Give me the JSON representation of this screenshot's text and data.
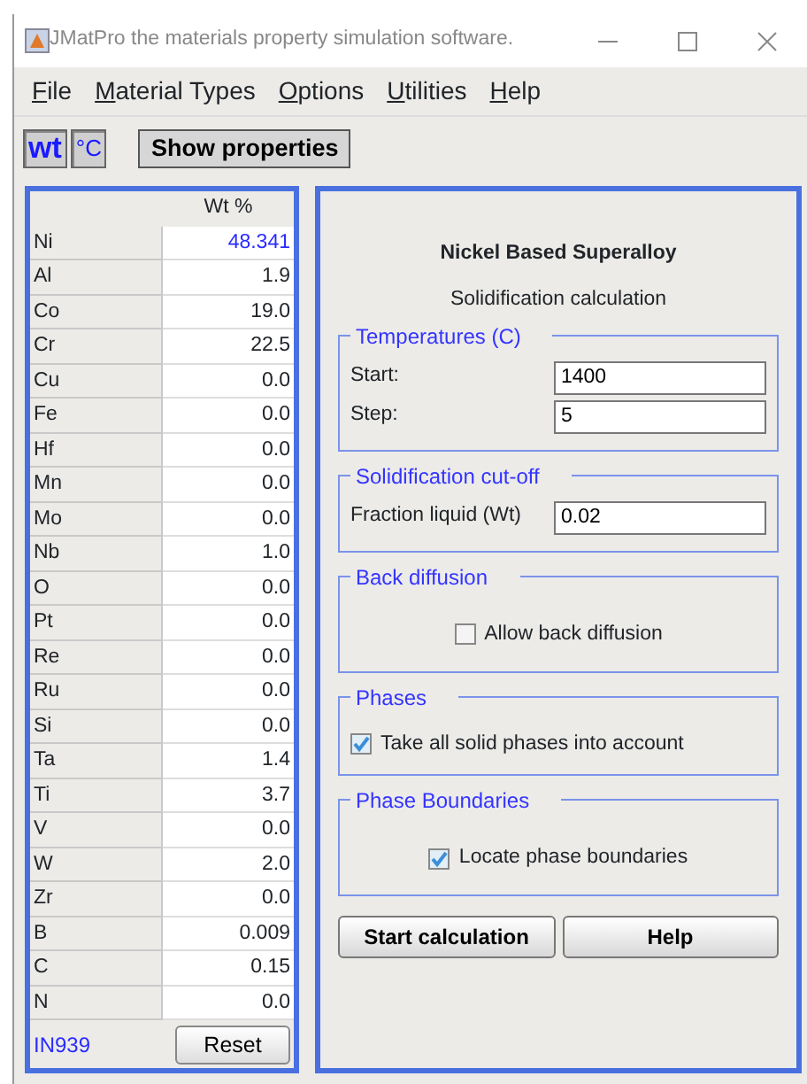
{
  "window": {
    "title": "JMatPro the materials property simulation software."
  },
  "menu": [
    {
      "label": "File",
      "underline_first": true
    },
    {
      "label": "Material Types",
      "underline_first": true
    },
    {
      "label": "Options",
      "underline_first": true
    },
    {
      "label": "Utilities",
      "underline_first": true
    },
    {
      "label": "Help",
      "underline_first": true
    }
  ],
  "toolbar": {
    "units": [
      {
        "label": "wt",
        "selected": true
      },
      {
        "label": "°C",
        "selected": false
      }
    ],
    "show_button": "Show properties"
  },
  "composition": {
    "column_header": "Wt %",
    "rows": [
      {
        "element": "Ni",
        "value": "48.341",
        "highlighted": true
      },
      {
        "element": "Al",
        "value": "1.9",
        "highlighted": false
      },
      {
        "element": "Co",
        "value": "19.0",
        "highlighted": false
      },
      {
        "element": "Cr",
        "value": "22.5",
        "highlighted": false
      },
      {
        "element": "Cu",
        "value": "0.0",
        "highlighted": false
      },
      {
        "element": "Fe",
        "value": "0.0",
        "highlighted": false
      },
      {
        "element": "Hf",
        "value": "0.0",
        "highlighted": false
      },
      {
        "element": "Mn",
        "value": "0.0",
        "highlighted": false
      },
      {
        "element": "Mo",
        "value": "0.0",
        "highlighted": false
      },
      {
        "element": "Nb",
        "value": "1.0",
        "highlighted": false
      },
      {
        "element": "O",
        "value": "0.0",
        "highlighted": false
      },
      {
        "element": "Pt",
        "value": "0.0",
        "highlighted": false
      },
      {
        "element": "Re",
        "value": "0.0",
        "highlighted": false
      },
      {
        "element": "Ru",
        "value": "0.0",
        "highlighted": false
      },
      {
        "element": "Si",
        "value": "0.0",
        "highlighted": false
      },
      {
        "element": "Ta",
        "value": "1.4",
        "highlighted": false
      },
      {
        "element": "Ti",
        "value": "3.7",
        "highlighted": false
      },
      {
        "element": "V",
        "value": "0.0",
        "highlighted": false
      },
      {
        "element": "W",
        "value": "2.0",
        "highlighted": false
      },
      {
        "element": "Zr",
        "value": "0.0",
        "highlighted": false
      },
      {
        "element": "B",
        "value": "0.009",
        "highlighted": false
      },
      {
        "element": "C",
        "value": "0.15",
        "highlighted": false
      },
      {
        "element": "N",
        "value": "0.0",
        "highlighted": false
      }
    ],
    "alloy_name": "IN939",
    "reset_button": "Reset"
  },
  "calculation": {
    "title": "Nickel Based Superalloy",
    "subtitle": "Solidification calculation",
    "groups": [
      {
        "legend": "Temperatures (C)",
        "kind": "fields",
        "fields": [
          {
            "label": "Start:",
            "value": "1400"
          },
          {
            "label": "Step:",
            "value": "5"
          }
        ]
      },
      {
        "legend": "Solidification cut-off",
        "kind": "fields",
        "fields": [
          {
            "label": "Fraction liquid (Wt)",
            "value": "0.02"
          }
        ]
      },
      {
        "legend": "Back diffusion",
        "kind": "checkbox",
        "centered": true,
        "label": "Allow back diffusion",
        "checked": false
      },
      {
        "legend": "Phases",
        "kind": "checkbox",
        "centered": false,
        "label": "Take all solid phases into account",
        "checked": true
      },
      {
        "legend": "Phase Boundaries",
        "kind": "checkbox",
        "centered": true,
        "label": "Locate phase boundaries",
        "checked": true
      }
    ],
    "buttons": [
      "Start calculation",
      "Help"
    ]
  }
}
